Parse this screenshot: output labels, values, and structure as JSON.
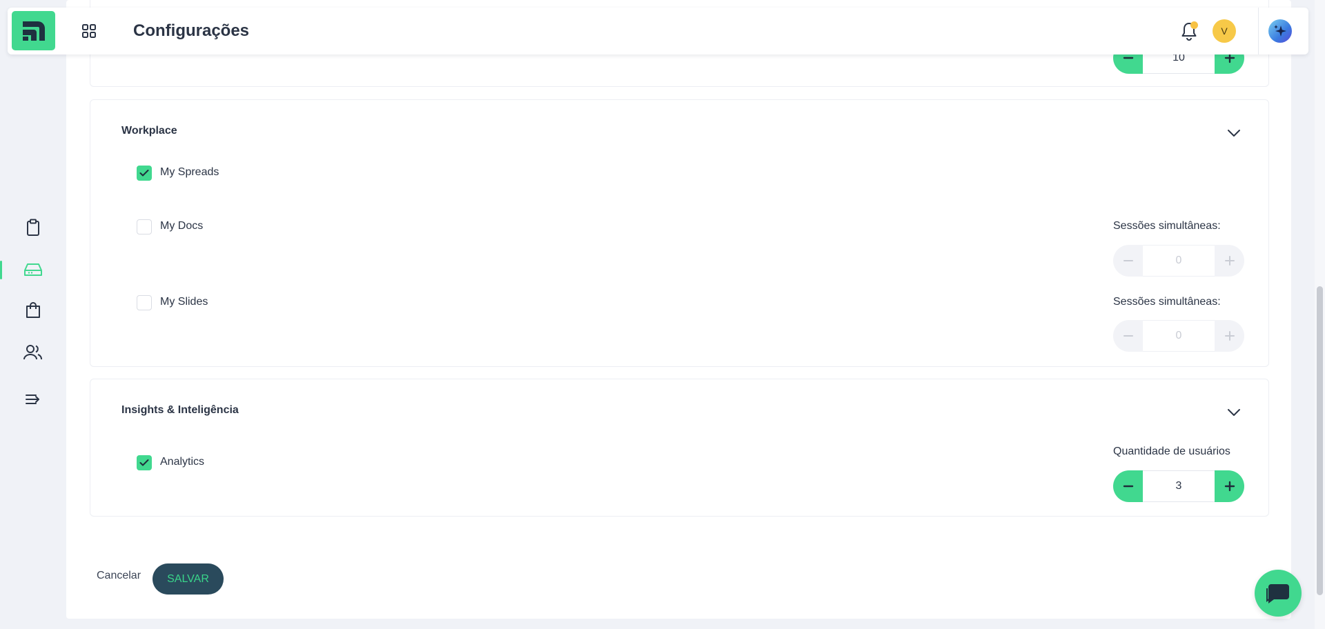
{
  "header": {
    "title": "Configurações",
    "avatar_initial": "V",
    "icons": {
      "apps": "grid-icon",
      "notifications": "bell-icon",
      "assistant": "sparkles-icon"
    }
  },
  "sidebar": {
    "items": [
      {
        "name": "clipboard-icon"
      },
      {
        "name": "drive-icon",
        "active": true
      },
      {
        "name": "shopping-bag-icon"
      },
      {
        "name": "users-icon"
      },
      {
        "name": "collapse-icon"
      }
    ]
  },
  "top_partial_stepper": {
    "value": "10"
  },
  "workplace": {
    "title": "Workplace",
    "items": [
      {
        "label": "My Spreads",
        "checked": true
      },
      {
        "label": "My Docs",
        "checked": false,
        "field_label": "Sessões simultâneas:",
        "value": "0"
      },
      {
        "label": "My Slides",
        "checked": false,
        "field_label": "Sessões simultâneas:",
        "value": "0"
      }
    ]
  },
  "insights": {
    "title": "Insights & Inteligência",
    "items": [
      {
        "label": "Analytics",
        "checked": true,
        "field_label": "Quantidade de usuários",
        "value": "3"
      }
    ]
  },
  "footer": {
    "cancel_label": "Cancelar",
    "save_label": "SALVAR"
  },
  "colors": {
    "accent": "#41d88f",
    "save_bg": "#2a4a5c",
    "notification_dot": "#f7c244",
    "avatar_bg": "#f7c948"
  }
}
